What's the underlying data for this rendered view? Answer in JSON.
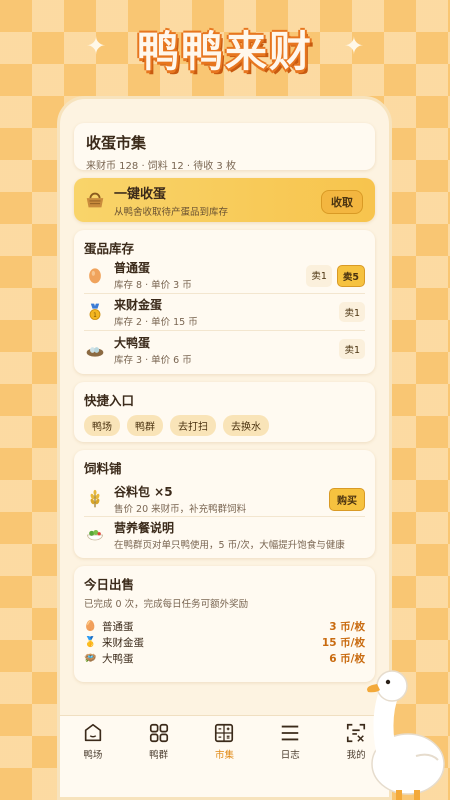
{
  "app": {
    "title": "鸭鸭来财"
  },
  "header": {
    "title": "收蛋市集",
    "stats": "来财币 128 · 饲料 12 · 待收 3 枚"
  },
  "collect": {
    "title": "一键收蛋",
    "desc": "从鸭舍收取待产蛋品到库存",
    "button": "收取"
  },
  "inventory": {
    "title": "蛋品库存",
    "items": [
      {
        "name": "普通蛋",
        "meta": "库存 8 · 单价 3 币",
        "icon": "egg-icon",
        "actions": [
          "卖1",
          "卖5"
        ]
      },
      {
        "name": "来财金蛋",
        "meta": "库存 2 · 单价 15 币",
        "icon": "gold-medal-icon",
        "actions": [
          "卖1"
        ]
      },
      {
        "name": "大鸭蛋",
        "meta": "库存 3 · 单价 6 币",
        "icon": "nest-icon",
        "actions": [
          "卖1"
        ]
      }
    ]
  },
  "quick": {
    "title": "快捷入口",
    "chips": [
      "鸭场",
      "鸭群",
      "去打扫",
      "去换水"
    ]
  },
  "feed": {
    "title": "饲料铺",
    "pack": {
      "name": "谷料包 ×5",
      "desc": "售价 20 来财币，补充鸭群饲料",
      "button": "购买",
      "icon": "grain-icon"
    },
    "meal": {
      "name": "营养餐说明",
      "desc": "在鸭群页对单只鸭使用，5 币/次，大幅提升饱食与健康",
      "icon": "salad-icon"
    }
  },
  "today": {
    "title": "今日出售",
    "desc": "已完成 0 次，完成每日任务可额外奖励",
    "prices": [
      {
        "name": "普通蛋",
        "price": "3 币/枚",
        "icon": "egg-icon"
      },
      {
        "name": "来财金蛋",
        "price": "15 币/枚",
        "icon": "gold-medal-icon"
      },
      {
        "name": "大鸭蛋",
        "price": "6 币/枚",
        "icon": "nest-icon"
      }
    ]
  },
  "tabs": [
    {
      "label": "鸭场",
      "icon": "home-icon"
    },
    {
      "label": "鸭群",
      "icon": "grid-icon"
    },
    {
      "label": "市集",
      "icon": "calculator-icon",
      "active": true
    },
    {
      "label": "日志",
      "icon": "list-icon"
    },
    {
      "label": "我的",
      "icon": "profile-icon"
    }
  ],
  "colors": {
    "accent": "#f6c23f",
    "price": "#c96b10",
    "active_tab": "#e08a17",
    "background": "#f9c673"
  }
}
